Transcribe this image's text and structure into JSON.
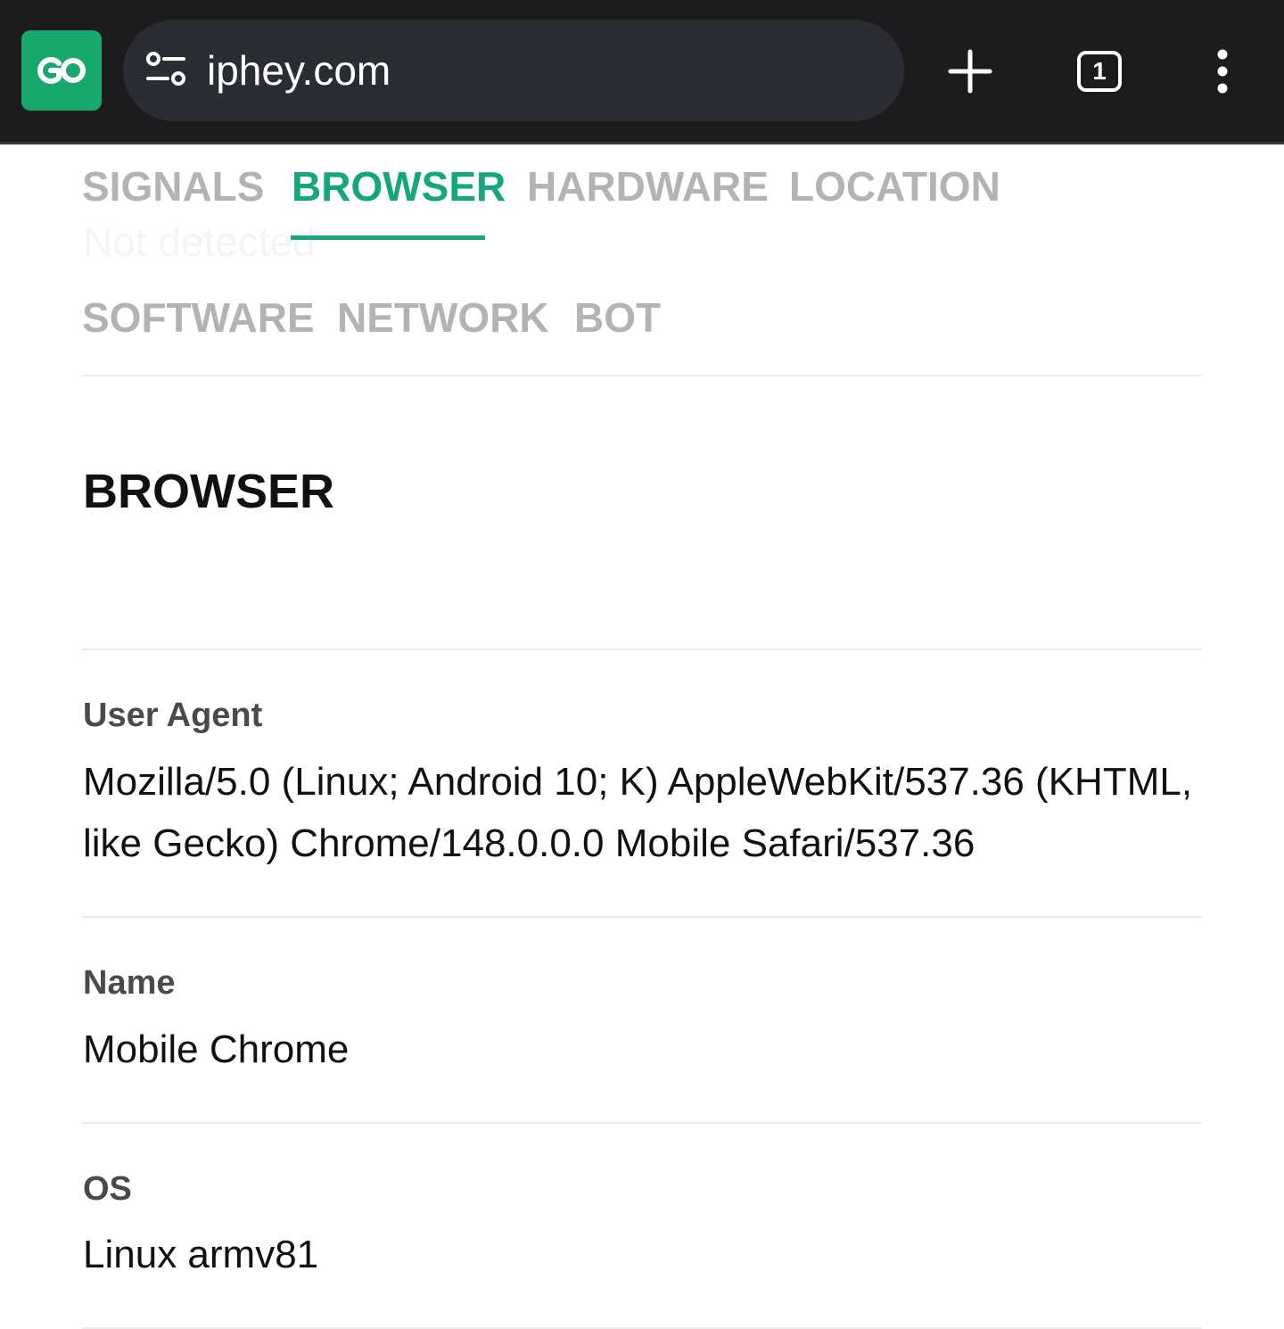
{
  "browser_bar": {
    "url": "iphey.com",
    "tab_count": "1",
    "extension_color": "#18a86b"
  },
  "nav": {
    "tabs": [
      {
        "label": "SIGNALS"
      },
      {
        "label": "BROWSER"
      },
      {
        "label": "HARDWARE"
      },
      {
        "label": "LOCATION"
      },
      {
        "label": "SOFTWARE"
      },
      {
        "label": "NETWORK"
      },
      {
        "label": "BOT"
      }
    ],
    "active_tab": "BROWSER",
    "active_color": "#14a67d",
    "overlay_text": "Not detected"
  },
  "section": {
    "title": "BROWSER",
    "fields": [
      {
        "label": "User Agent",
        "value": "Mozilla/5.0 (Linux; Android 10; K) AppleWebKit/537.36 (KHTML, like Gecko) Chrome/148.0.0.0 Mobile Safari/537.36"
      },
      {
        "label": "Name",
        "value": "Mobile Chrome"
      },
      {
        "label": "OS",
        "value": "Linux armv81"
      }
    ]
  }
}
